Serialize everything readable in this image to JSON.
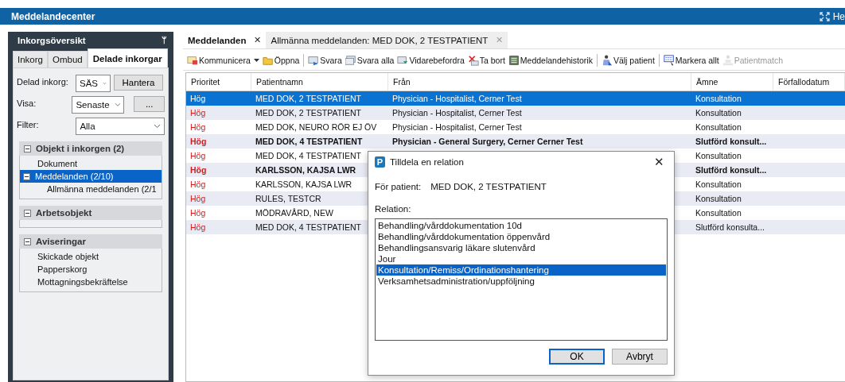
{
  "window": {
    "title": "Meddelandecenter",
    "right_text": "He"
  },
  "sidebar": {
    "title": "Inkorgsöversikt",
    "pin": "ᛘ",
    "tabs": [
      {
        "label": "Inkorg",
        "selected": false
      },
      {
        "label": "Ombud",
        "selected": false
      },
      {
        "label": "Delade inkorgar",
        "selected": true
      }
    ],
    "shared_inbox": {
      "label": "Delad inkorg:",
      "value": "SÄS",
      "button": "Hantera"
    },
    "show": {
      "label": "Visa:",
      "value": "Senaste",
      "button": "..."
    },
    "filter": {
      "label": "Filter:",
      "value": "Alla"
    },
    "sections": [
      {
        "title": "Objekt i inkorgen (2)",
        "expanded": true,
        "items": [
          {
            "label": "Dokument",
            "selected": false
          },
          {
            "label": "Meddelanden (2/10)",
            "selected": true,
            "expanded": true,
            "children": [
              {
                "label": "Allmänna meddelanden (2/1",
                "selected": false
              }
            ]
          }
        ]
      },
      {
        "title": "Arbetsobjekt",
        "expanded": true
      },
      {
        "title": "Aviseringar",
        "expanded": true,
        "items": [
          {
            "label": "Skickade objekt",
            "selected": false
          },
          {
            "label": "Papperskorg",
            "selected": false
          },
          {
            "label": "Mottagningsbekräftelse",
            "selected": false
          }
        ]
      }
    ]
  },
  "doc_tabs": [
    {
      "label": "Meddelanden",
      "selected": true,
      "close": "✕"
    },
    {
      "label": "Allmänna meddelanden: MED DOK, 2 TESTPATIENT",
      "selected": false,
      "close": "✕"
    }
  ],
  "toolbar": [
    {
      "kind": "button",
      "label": "Kommunicera",
      "dropdown": true,
      "disabled": false
    },
    {
      "kind": "button",
      "label": "Öppna",
      "dropdown": false,
      "disabled": false
    },
    {
      "kind": "separator"
    },
    {
      "kind": "button",
      "label": "Svara",
      "dropdown": false,
      "disabled": false
    },
    {
      "kind": "button",
      "label": "Svara alla",
      "dropdown": false,
      "disabled": false
    },
    {
      "kind": "button",
      "label": "Vidarebefordra",
      "dropdown": false,
      "disabled": false
    },
    {
      "kind": "button",
      "label": "Ta bort",
      "dropdown": false,
      "disabled": false
    },
    {
      "kind": "button",
      "label": "Meddelandehistorik",
      "dropdown": false,
      "disabled": false
    },
    {
      "kind": "separator"
    },
    {
      "kind": "button",
      "label": "Välj patient",
      "dropdown": false,
      "disabled": false
    },
    {
      "kind": "separator"
    },
    {
      "kind": "button",
      "label": "Markera allt",
      "dropdown": false,
      "disabled": false
    },
    {
      "kind": "button",
      "label": "Patientmatch",
      "dropdown": false,
      "disabled": true
    }
  ],
  "table": {
    "columns": [
      "Prioritet",
      "Patientnamn",
      "Från",
      "Ämne",
      "Förfallodatum"
    ],
    "rows": [
      {
        "priority": "Hög",
        "patient": "MED DOK, 2 TESTPATIENT",
        "from": "Physician - Hospitalist, Cerner Test",
        "subject": "Konsultation",
        "selected": true,
        "bold": false
      },
      {
        "priority": "Hög",
        "patient": "MED DOK, 2 TESTPATIENT",
        "from": "Physician - Hospitalist, Cerner Test",
        "subject": "Konsultation",
        "selected": false,
        "bold": false
      },
      {
        "priority": "Hög",
        "patient": "MED DOK, NEURO RÖR EJ ÖV",
        "from": "Physician - Hospitalist, Cerner Test",
        "subject": "Konsultation",
        "selected": false,
        "bold": false
      },
      {
        "priority": "Hög",
        "patient": "MED DOK, 4 TESTPATIENT",
        "from": "Physician - General Surgery, Cerner Cerner Test",
        "subject": "Slutförd konsult...",
        "selected": false,
        "bold": true
      },
      {
        "priority": "Hög",
        "patient": "MED DOK, 4 TESTPATIENT",
        "subject": "Konsultation",
        "selected": false,
        "bold": false
      },
      {
        "priority": "Hög",
        "patient": "KARLSSON, KAJSA LWR",
        "subject": "Slutförd konsult...",
        "selected": false,
        "bold": true
      },
      {
        "priority": "Hög",
        "patient": "KARLSSON, KAJSA LWR",
        "subject": "Konsultation",
        "selected": false,
        "bold": false
      },
      {
        "priority": "Hög",
        "patient": "RULES, TESTCR",
        "subject": "Konsultation",
        "selected": false,
        "bold": false
      },
      {
        "priority": "Hög",
        "patient": "MÖDRAVÅRD, NEW",
        "subject": "Konsultation",
        "selected": false,
        "bold": false
      },
      {
        "priority": "Hög",
        "patient": "MED DOK, 4 TESTPATIENT",
        "subject": "Slutförd konsulta...",
        "selected": false,
        "bold": false
      }
    ]
  },
  "dialog": {
    "logo": "P",
    "title": "Tilldela en relation",
    "close": "✕",
    "patient_label": "För patient:",
    "patient": "MED DOK, 2 TESTPATIENT",
    "relation_label": "Relation:",
    "relations": [
      {
        "label": "Behandling/vårddokumentation 10d",
        "selected": false
      },
      {
        "label": "Behandling/vårddokumentation öppenvård",
        "selected": false
      },
      {
        "label": "Behandlingsansvarig läkare slutenvård",
        "selected": false
      },
      {
        "label": "Jour",
        "selected": false
      },
      {
        "label": "Konsultation/Remiss/Ordinationshantering",
        "selected": true
      },
      {
        "label": "Verksamhetsadministration/uppföljning",
        "selected": false
      }
    ],
    "buttons": [
      {
        "label": "OK",
        "default": true
      },
      {
        "label": "Avbryt",
        "default": false
      }
    ]
  }
}
